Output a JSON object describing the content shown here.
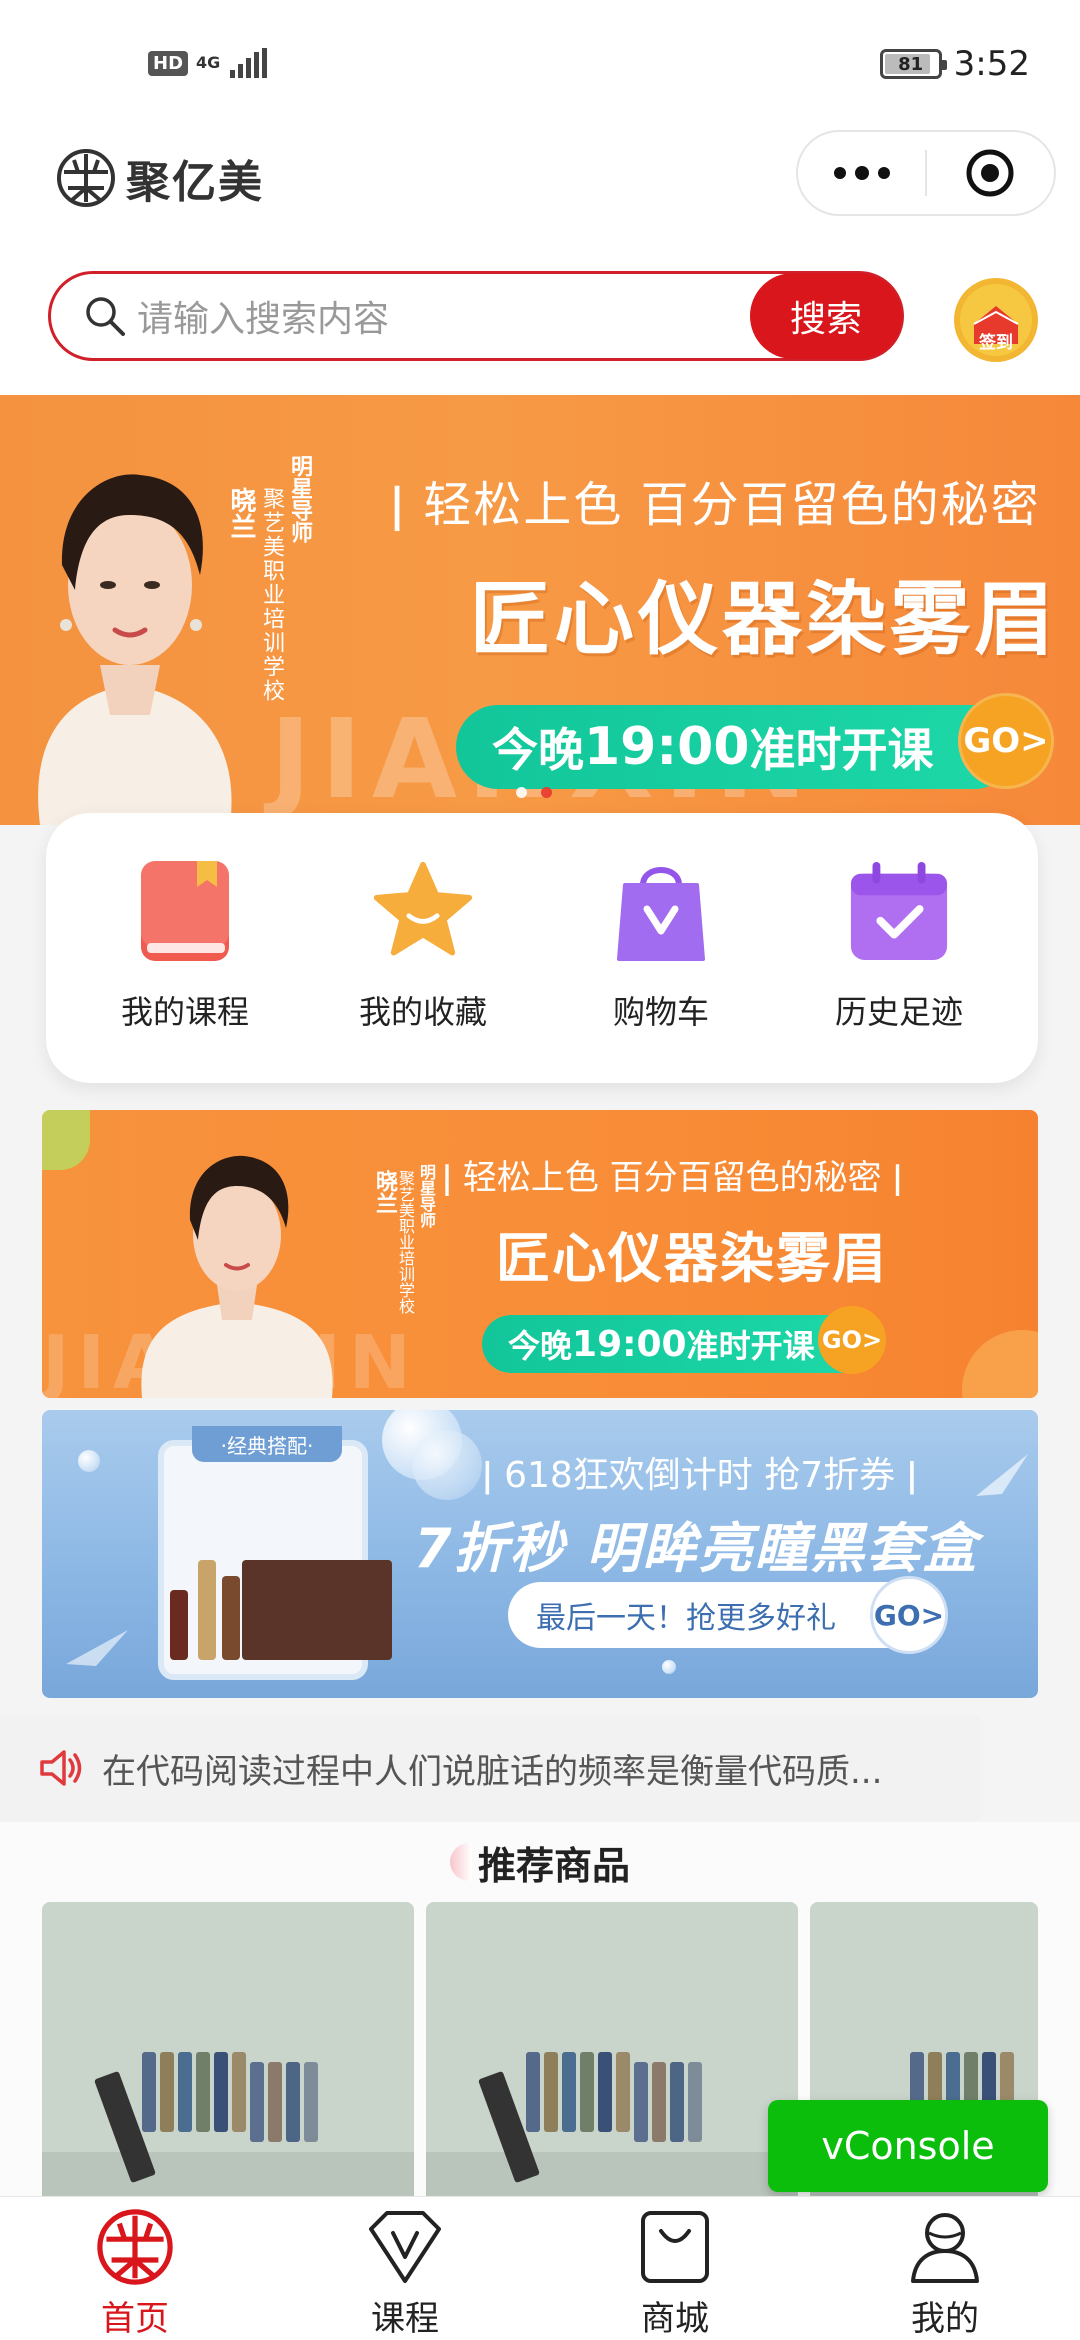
{
  "status_bar": {
    "hd_badge": "HD",
    "network": "4G",
    "battery_level": "81",
    "time": "3:52"
  },
  "header": {
    "app_title": "聚亿美",
    "menu_icon": "more-dots-icon",
    "close_icon": "target-close-icon"
  },
  "search": {
    "placeholder": "请输入搜索内容",
    "button_label": "搜索",
    "signin_label": "签到"
  },
  "banner": {
    "person_name": "晓兰",
    "person_title": "明星导师",
    "person_school": "聚艺美职业培训学校",
    "subtitle": "轻松上色 百分百留色的秘密",
    "title": "匠心仪器染雾眉",
    "cta_prefix": "今晚",
    "cta_time": "19:00",
    "cta_suffix": "准时开课",
    "go_label": "GO>",
    "watermark": "JIANXIN",
    "slide_count": 2,
    "active_slide": 2
  },
  "quick_nav": [
    {
      "label": "我的课程",
      "icon": "book-icon"
    },
    {
      "label": "我的收藏",
      "icon": "star-icon"
    },
    {
      "label": "购物车",
      "icon": "shopping-bag-icon"
    },
    {
      "label": "历史足迹",
      "icon": "calendar-check-icon"
    }
  ],
  "promo1": {
    "person_name": "晓兰",
    "person_title": "明星导师",
    "person_school": "聚艺美职业培训学校",
    "subtitle": "轻松上色 百分百留色的秘密",
    "title": "匠心仪器染雾眉",
    "cta_prefix": "今晚",
    "cta_time": "19:00",
    "cta_suffix": "准时开课",
    "go_label": "GO>",
    "watermark": "JIANXIN"
  },
  "promo2": {
    "tag": "·经典搭配·",
    "subtitle": "618狂欢倒计时 抢7折券",
    "title": "7折秒 明眸亮瞳黑套盒",
    "cta": "最后一天！抢更多好礼",
    "go_label": "GO>"
  },
  "notice": {
    "icon": "speaker-icon",
    "text": "在代码阅读过程中人们说脏话的频率是衡量代码质..."
  },
  "recommend": {
    "title": "推荐商品"
  },
  "vconsole": {
    "label": "vConsole"
  },
  "tabbar": [
    {
      "label": "首页",
      "icon": "home-logo-icon",
      "active": true
    },
    {
      "label": "课程",
      "icon": "course-v-icon",
      "active": false
    },
    {
      "label": "商城",
      "icon": "shop-bag-icon",
      "active": false
    },
    {
      "label": "我的",
      "icon": "user-icon",
      "active": false
    }
  ],
  "colors": {
    "accent": "#d8161c",
    "banner_orange": "#f79a45",
    "cta_green": "#1dd8a8",
    "promo_blue": "#8ab6e4",
    "vconsole_green": "#0bbe0b"
  }
}
